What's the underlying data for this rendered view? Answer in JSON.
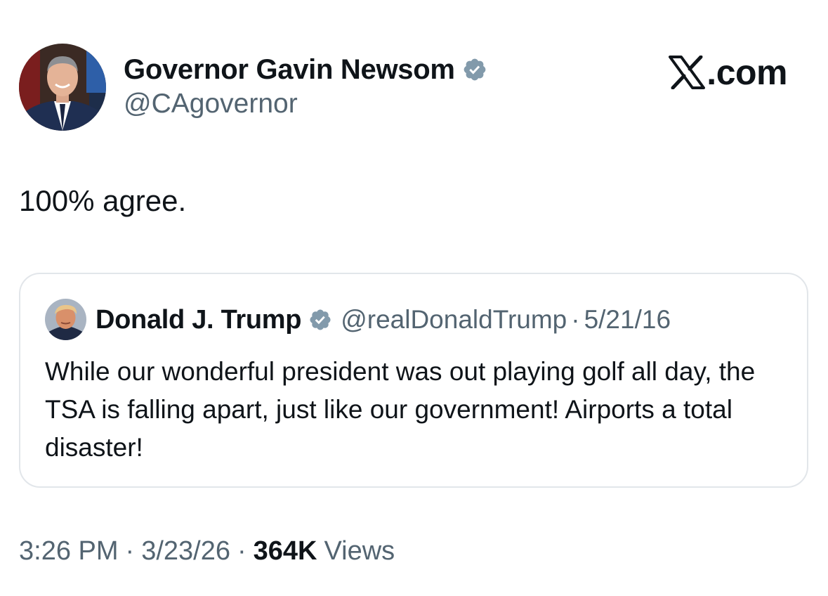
{
  "author": {
    "display_name": "Governor Gavin Newsom",
    "handle": "@CAgovernor",
    "verified": true,
    "avatar": "portrait-photo"
  },
  "brand": {
    "logo_icon": "x-logo-icon",
    "text": ".com"
  },
  "tweet": {
    "text": "100% agree."
  },
  "quoted_tweet": {
    "display_name": "Donald J. Trump",
    "handle": "@realDonaldTrump",
    "separator": "·",
    "date": "5/21/16",
    "verified": true,
    "avatar": "portrait-photo",
    "text": "While our wonderful president was out playing golf all day, the TSA is falling apart, just like our government! Airports a total disaster!"
  },
  "meta": {
    "time": "3:26 PM",
    "separator": "·",
    "date": "3/23/26",
    "views_count": "364K",
    "views_label": "Views"
  },
  "colors": {
    "text_primary": "#0f1419",
    "text_secondary": "#536471",
    "verified_badge": "#829aab",
    "card_border": "#e2e6ea",
    "background": "#ffffff"
  }
}
